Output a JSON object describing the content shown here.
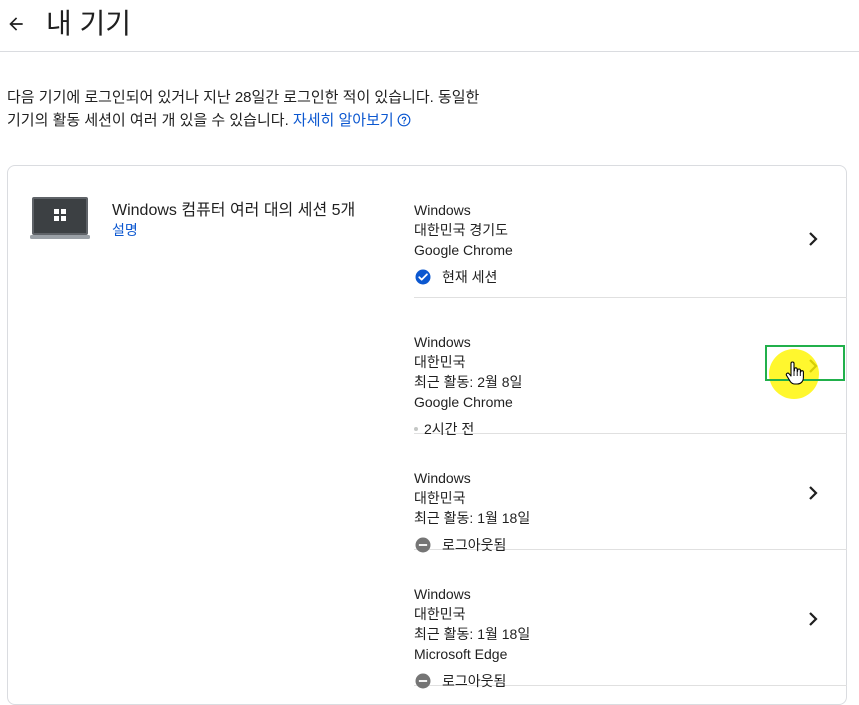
{
  "header": {
    "back_icon": "arrow-left-icon",
    "title": "내 기기"
  },
  "intro": {
    "line1": "다음 기기에 로그인되어 있거나 지난 28일간 로그인한 적이 있습니다. 동일한",
    "line2": "기기의 활동 세션이 여러 개 있을 수 있습니다.",
    "learn_more": "자세히 알아보기",
    "help_icon": "help-circle-icon"
  },
  "device_group": {
    "icon": "laptop-windows-icon",
    "title": "Windows 컴퓨터 여러 대의 세션 5개",
    "details_link": "설명",
    "sessions": [
      {
        "os": "Windows",
        "location": "대한민국 경기도",
        "browser": "Google Chrome",
        "status": "현재 세션",
        "status_icon": "check-circle-icon"
      },
      {
        "os": "Windows",
        "location": "대한민국",
        "last_activity": "최근 활동: 2월 8일",
        "browser": "Google Chrome",
        "status": "2시간 전",
        "status_icon": "dot-icon"
      },
      {
        "os": "Windows",
        "location": "대한민국",
        "last_activity": "최근 활동: 1월 18일",
        "status": "로그아웃됨",
        "status_icon": "minus-circle-icon"
      },
      {
        "os": "Windows",
        "location": "대한민국",
        "last_activity": "최근 활동: 1월 18일",
        "browser": "Microsoft Edge",
        "status": "로그아웃됨",
        "status_icon": "minus-circle-icon"
      }
    ]
  },
  "colors": {
    "link": "#0b57d0",
    "check": "#0b57d0",
    "signed_out": "#757575",
    "divider": "#e0e0e0",
    "highlight": "#fff500",
    "focus_box": "#21b04b"
  }
}
